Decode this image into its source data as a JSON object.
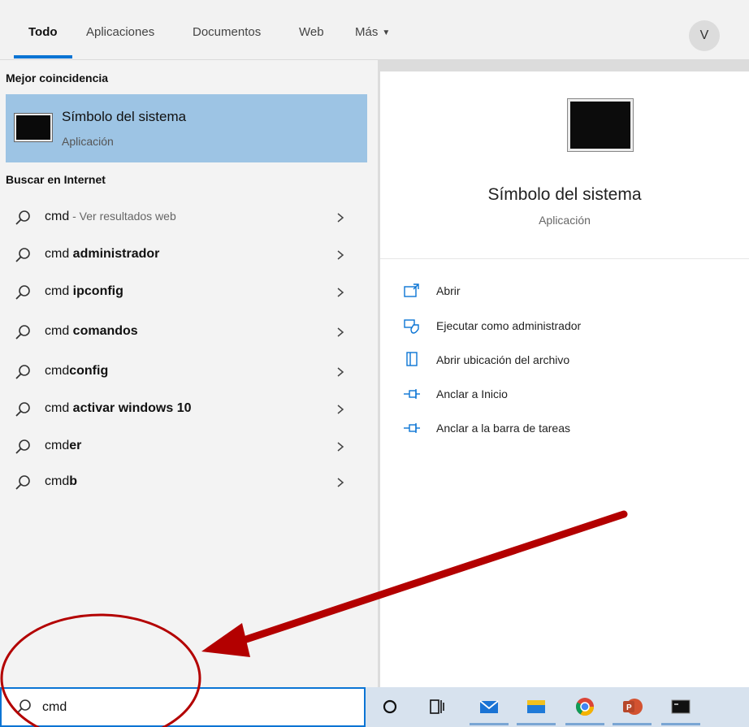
{
  "tabs": {
    "todo": "Todo",
    "aplicaciones": "Aplicaciones",
    "documentos": "Documentos",
    "web": "Web",
    "mas": "Más"
  },
  "user": {
    "avatar_initial": "V"
  },
  "best_match": {
    "header": "Mejor coincidencia",
    "title": "Símbolo del sistema",
    "subtitle": "Aplicación"
  },
  "web_search": {
    "header": "Buscar en Internet",
    "items": [
      {
        "prefix": "cmd",
        "bold": "",
        "suffix": " - Ver resultados web"
      },
      {
        "prefix": "cmd ",
        "bold": "administrador",
        "suffix": ""
      },
      {
        "prefix": "cmd ",
        "bold": "ipconfig",
        "suffix": ""
      },
      {
        "prefix": "cmd ",
        "bold": "comandos",
        "suffix": ""
      },
      {
        "prefix": "cmd",
        "bold": "config",
        "suffix": ""
      },
      {
        "prefix": "cmd ",
        "bold": "activar windows 10",
        "suffix": ""
      },
      {
        "prefix": "cmd",
        "bold": "er",
        "suffix": ""
      },
      {
        "prefix": "cmd",
        "bold": "b",
        "suffix": ""
      }
    ]
  },
  "preview": {
    "title": "Símbolo del sistema",
    "subtitle": "Aplicación",
    "actions": [
      {
        "label": "Abrir",
        "icon": "open-icon"
      },
      {
        "label": "Ejecutar como administrador",
        "icon": "shield-icon"
      },
      {
        "label": "Abrir ubicación del archivo",
        "icon": "file-location-icon"
      },
      {
        "label": "Anclar a Inicio",
        "icon": "pin-icon"
      },
      {
        "label": "Anclar a la barra de tareas",
        "icon": "pin-icon"
      }
    ]
  },
  "search": {
    "value": "cmd"
  },
  "taskbar": {
    "items": [
      "cortana-icon",
      "task-view-icon",
      "mail-icon",
      "file-explorer-icon",
      "chrome-icon",
      "powerpoint-icon",
      "cmd-icon"
    ]
  },
  "colors": {
    "accent": "#0a74d4",
    "selection": "#9dc4e4",
    "annotation": "#b30000"
  }
}
